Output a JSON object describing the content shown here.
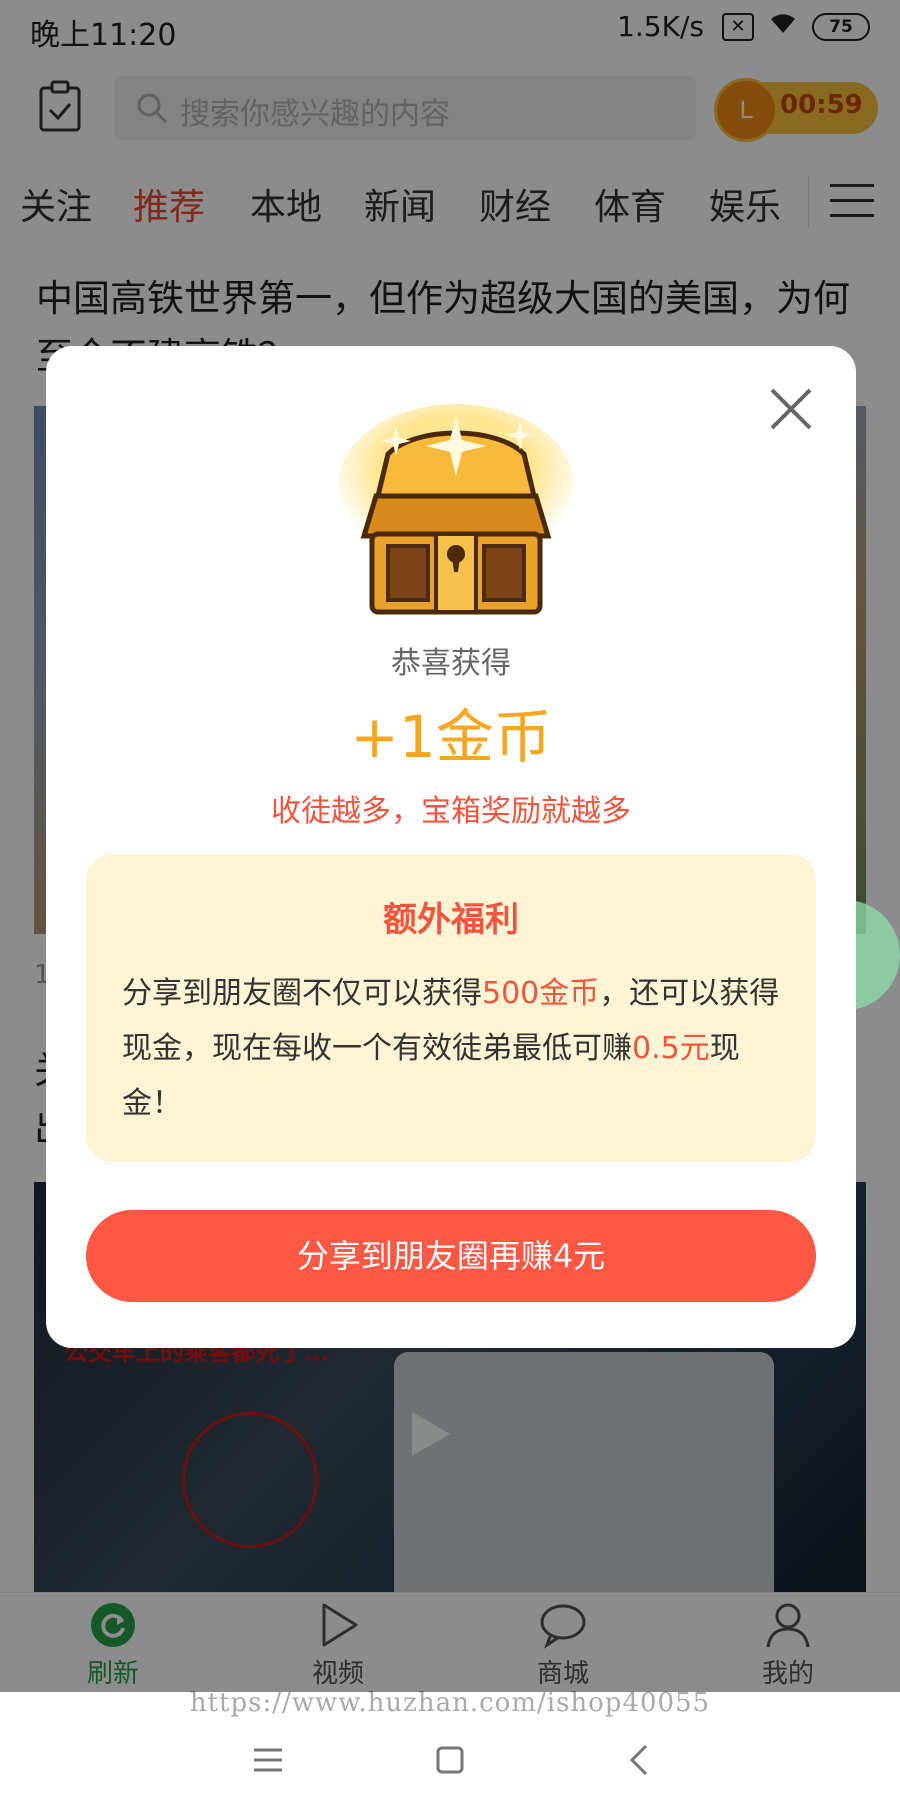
{
  "status_bar": {
    "time": "晚上11:20",
    "net_speed": "1.5K/s",
    "battery": "75"
  },
  "header": {
    "search_placeholder": "搜索你感兴趣的内容",
    "coin_badge": "L",
    "coin_timer": "00:59"
  },
  "tabs": [
    {
      "label": "关注"
    },
    {
      "label": "推荐",
      "active": true
    },
    {
      "label": "本地"
    },
    {
      "label": "新闻"
    },
    {
      "label": "财经"
    },
    {
      "label": "体育"
    },
    {
      "label": "娱乐"
    }
  ],
  "feed": {
    "article1_title": "中国高铁世界第一，但作为超级大国的美国，为何至今不建高铁？",
    "article1_meta": "1",
    "article2_title": "关",
    "article2_line2": "出",
    "video_caption": "公交车上的乘客都死了..."
  },
  "modal": {
    "congrats": "恭喜获得",
    "reward": "+1金币",
    "recruit_note": "收徒越多，宝箱奖励就越多",
    "bonus_title": "额外福利",
    "bonus_text_1": "分享到朋友圈不仅可以获得",
    "bonus_coins": "500金币",
    "bonus_text_2": "，还可以获得现金，现在每收一个有效徒弟最低可赚",
    "bonus_cash": "0.5元",
    "bonus_text_3": "现金！",
    "share_button": "分享到朋友圈再赚4元"
  },
  "bottom_nav": [
    {
      "label": "刷新",
      "icon": "refresh-icon",
      "active": true
    },
    {
      "label": "视频",
      "icon": "play-icon"
    },
    {
      "label": "商城",
      "icon": "chat-bubble-icon"
    },
    {
      "label": "我的",
      "icon": "user-icon"
    }
  ],
  "watermark": "https://www.huzhan.com/ishop40055",
  "colors": {
    "accent_red": "#fe5844",
    "coin_gold": "#f5a623",
    "active_green": "#27a34f",
    "bonus_bg": "#fff4d5"
  }
}
